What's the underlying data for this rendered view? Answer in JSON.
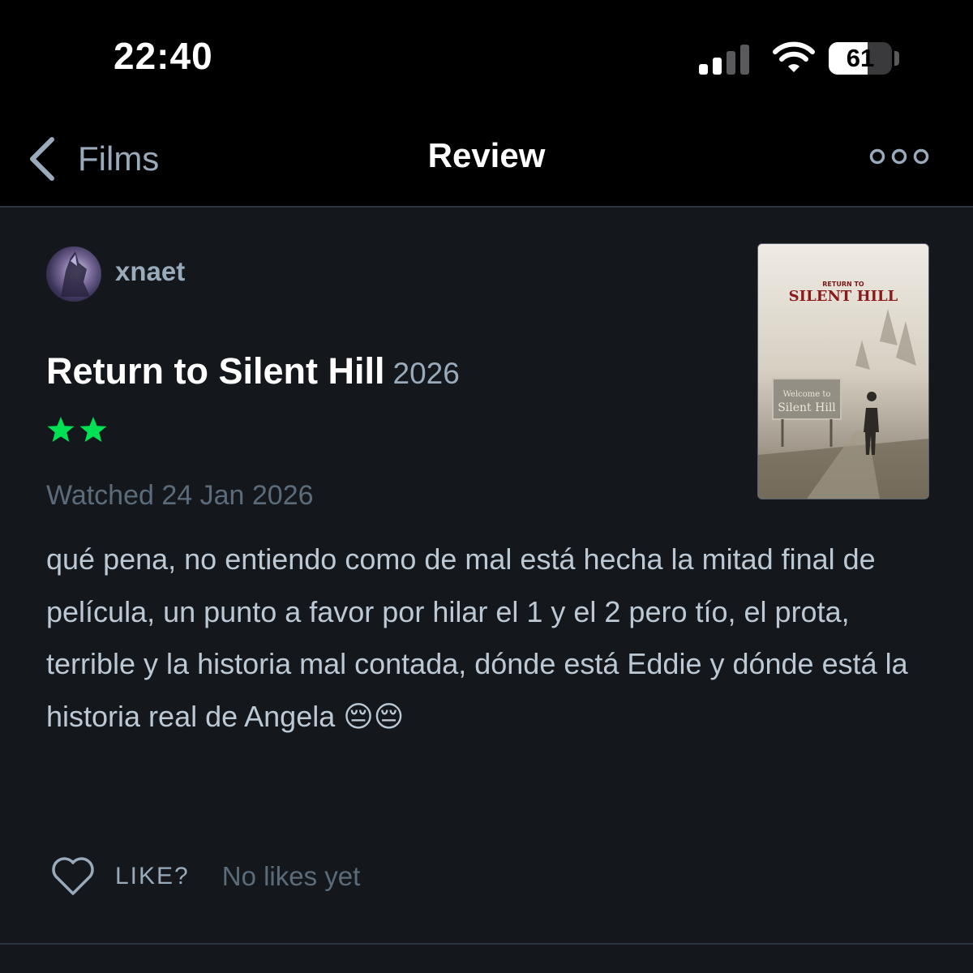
{
  "status_bar": {
    "time": "22:40",
    "battery_percent": "61",
    "battery_level": 0.61,
    "signal_bars_active": 2,
    "signal_bars_total": 4
  },
  "nav": {
    "back_label": "Films",
    "title": "Review",
    "back_icon": "chevron-left-icon",
    "more_icon": "more-horizontal-icon"
  },
  "review": {
    "username": "xnaet",
    "film_title": "Return to Silent Hill",
    "film_year": "2026",
    "rating_stars": 2,
    "watched": "Watched 24 Jan 2026",
    "text": "qué pena, no entiendo como de mal está hecha la mitad final de película, un punto a favor por hilar el 1 y el 2 pero tío, el prota, terrible y la historia mal contada, dónde está Eddie y dónde está la historia real de Angela 😔😔"
  },
  "poster": {
    "top_small": "RETURN TO",
    "top_big": "SILENT HILL",
    "sign_line1": "Welcome to",
    "sign_line2": "Silent Hill"
  },
  "like": {
    "label": "LIKE?",
    "count_text": "No likes yet"
  },
  "colors": {
    "background": "#14181c",
    "bar": "#000000",
    "accent_green": "#00e054",
    "muted": "#99aabb",
    "text": "#bcc8d4"
  }
}
